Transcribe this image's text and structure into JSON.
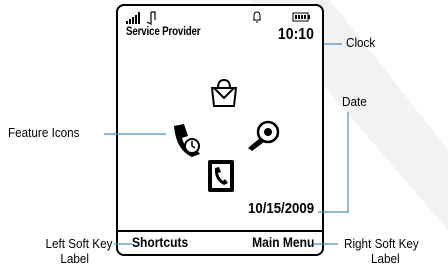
{
  "phone_screen": {
    "provider": "Service Provider",
    "clock": "10:10",
    "date": "10/15/2009",
    "soft_left": "Shortcuts",
    "soft_right": "Main Menu",
    "status_icons": [
      "signal-icon",
      "data-icon",
      "bell-icon",
      "battery-icon"
    ],
    "feature_icons": [
      "shopping-bag-icon",
      "call-log-icon",
      "bluetooth-headset-icon",
      "phonebook-icon"
    ]
  },
  "callouts": {
    "clock": "Clock",
    "date": "Date",
    "feature_icons": "Feature Icons",
    "left_softkey_line1": "Left Soft Key",
    "left_softkey_line2": "Label",
    "right_softkey_line1": "Right Soft Key",
    "right_softkey_line2": "Label"
  },
  "colors": {
    "stroke": "#000000",
    "leader": "#4a90c8",
    "watermark": "#f0f0f0"
  }
}
